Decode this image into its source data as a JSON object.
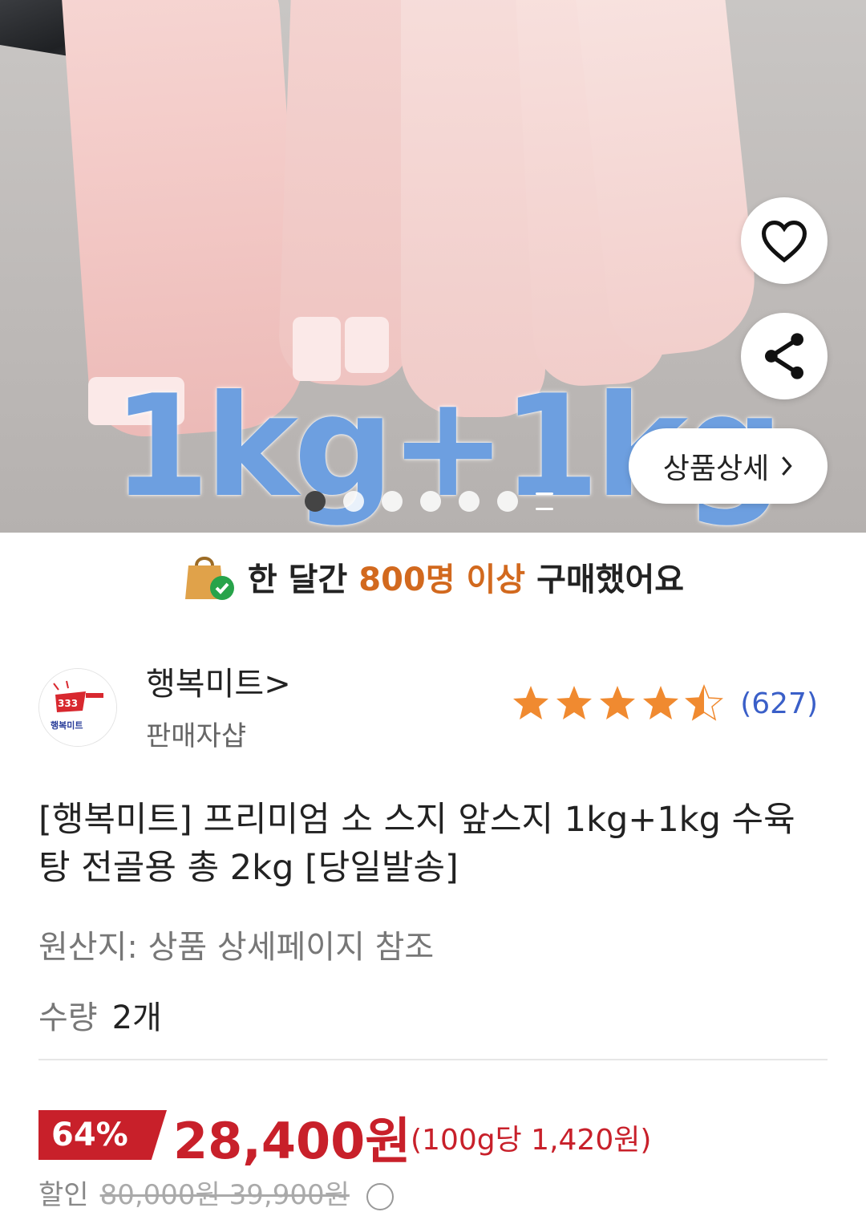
{
  "hero": {
    "overlay_text": "1kg+1kg",
    "detail_button_label": "상품상세",
    "pagination": {
      "active_index": 0,
      "total_dots": 6
    }
  },
  "purchase_banner": {
    "prefix": "한 달간",
    "highlight": "800명 이상",
    "suffix": "구매했어요",
    "highlight_color": "#d2691e"
  },
  "seller": {
    "name": "행복미트>",
    "subtitle": "판매자샵",
    "logo_text": "행복미트"
  },
  "rating": {
    "stars": 4.5,
    "count": "(627)",
    "star_color": "#f08a30"
  },
  "product": {
    "title": "[행복미트] 프리미엄 소 스지 앞스지 1kg+1kg 수육 탕 전골용 총 2kg [당일발송]",
    "origin": "원산지: 상품 상세페이지 참조",
    "quantity_label": "수량",
    "quantity_value": "2개"
  },
  "price": {
    "discount": "64%",
    "sale_price": "28,400원",
    "unit_price": "(100g당 1,420원)",
    "accent_color": "#c8202a",
    "bottom_label": "할인",
    "bottom_values": "80,000원 39,900원"
  }
}
